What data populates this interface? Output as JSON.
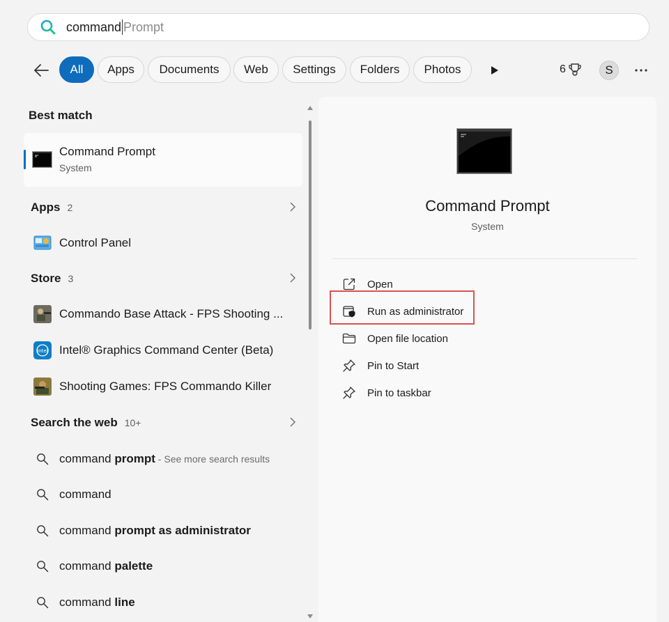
{
  "search": {
    "typed": "command",
    "suggestion": "Prompt"
  },
  "filters": {
    "tabs": [
      "All",
      "Apps",
      "Documents",
      "Web",
      "Settings",
      "Folders",
      "Photos"
    ],
    "points": "6",
    "avatar_initial": "S"
  },
  "results": {
    "best_match_title": "Best match",
    "best_match": {
      "name": "Command Prompt",
      "type": "System"
    },
    "apps": {
      "title": "Apps",
      "count": "2",
      "items": [
        "Control Panel"
      ]
    },
    "store": {
      "title": "Store",
      "count": "3",
      "items": [
        "Commando Base Attack - FPS Shooting ...",
        "Intel® Graphics Command Center (Beta)",
        "Shooting Games: FPS Commando Killer"
      ]
    },
    "web": {
      "title": "Search the web",
      "count": "10+",
      "items": [
        {
          "plain": "command ",
          "bold": "prompt",
          "suffix": " - See more search results"
        },
        {
          "plain": "command",
          "bold": "",
          "suffix": ""
        },
        {
          "plain": "command ",
          "bold": "prompt as administrator",
          "suffix": ""
        },
        {
          "plain": "command ",
          "bold": "palette",
          "suffix": ""
        },
        {
          "plain": "command ",
          "bold": "line",
          "suffix": ""
        }
      ]
    }
  },
  "preview": {
    "title": "Command Prompt",
    "subtitle": "System",
    "actions": [
      "Open",
      "Run as administrator",
      "Open file location",
      "Pin to Start",
      "Pin to taskbar"
    ]
  },
  "colors": {
    "accent": "#0f6cbd",
    "highlight": "#d9534f"
  }
}
